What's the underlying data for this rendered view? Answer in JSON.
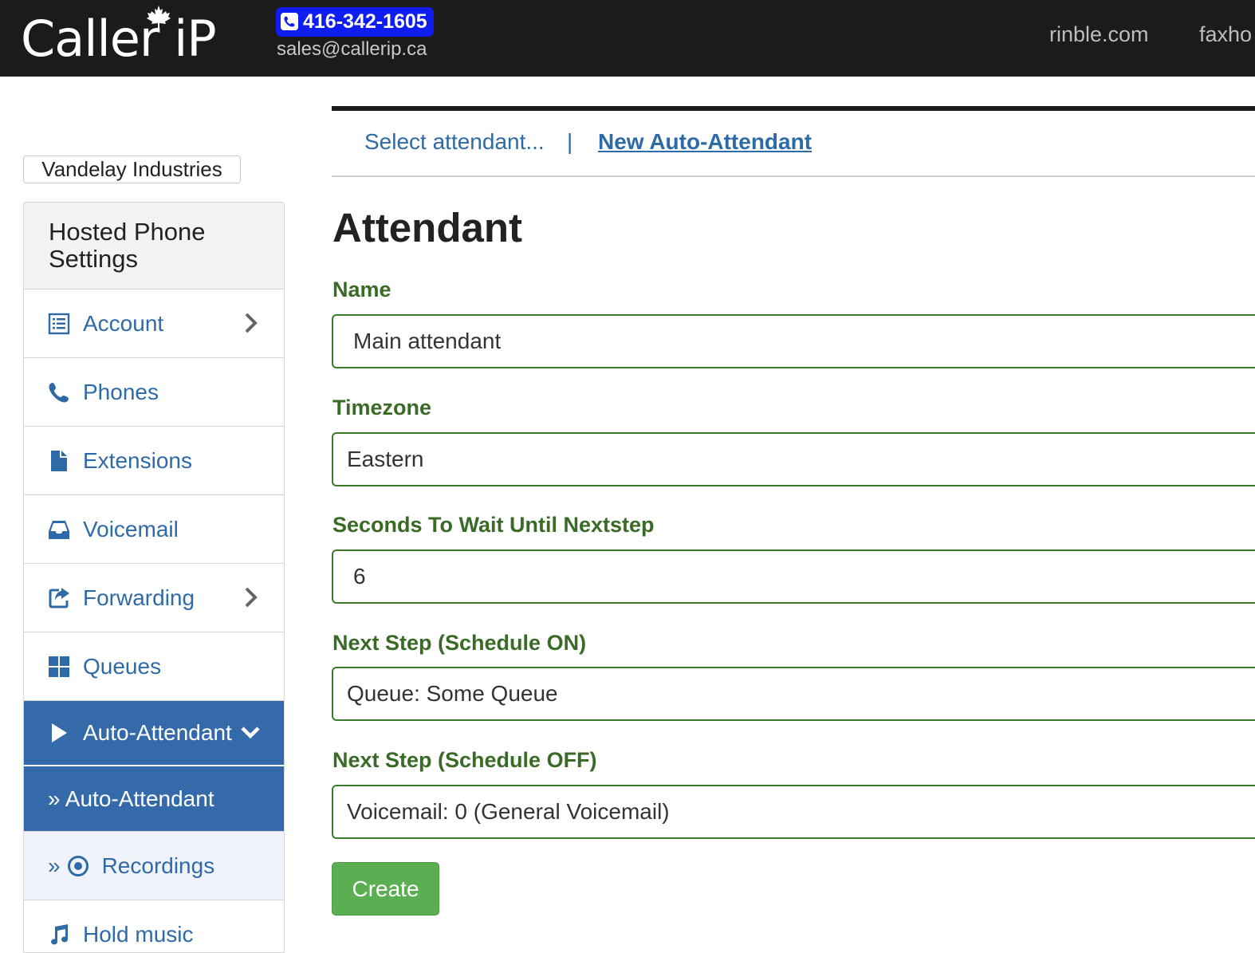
{
  "header": {
    "logo_text": "Caller iP",
    "phone": "416-342-1605",
    "email": "sales@callerip.ca",
    "links": [
      "rinble.com",
      "faxho"
    ]
  },
  "company": "Vandelay Industries",
  "sidebar": {
    "heading": "Hosted Phone Settings",
    "items": [
      {
        "label": "Account",
        "icon": "list-icon",
        "expandable": true
      },
      {
        "label": "Phones",
        "icon": "phone-icon"
      },
      {
        "label": "Extensions",
        "icon": "file-icon"
      },
      {
        "label": "Voicemail",
        "icon": "inbox-icon"
      },
      {
        "label": "Forwarding",
        "icon": "share-icon",
        "expandable": true
      },
      {
        "label": "Queues",
        "icon": "grid-icon"
      },
      {
        "label": "Auto-Attendant",
        "icon": "play-icon",
        "expanded": true,
        "active": true
      },
      {
        "label": "» Auto-Attendant",
        "active_sub": true
      },
      {
        "label": "Recordings",
        "prefix": "»",
        "icon": "record-icon"
      },
      {
        "label": "Hold music",
        "icon": "music-icon"
      }
    ]
  },
  "subnav": {
    "select_label": "Select attendant...",
    "separator": "|",
    "new_label": "New Auto-Attendant"
  },
  "form": {
    "title": "Attendant",
    "name_label": "Name",
    "name_value": "Main attendant",
    "timezone_label": "Timezone",
    "timezone_value": "Eastern",
    "wait_label": "Seconds To Wait Until Nextstep",
    "wait_value": "6",
    "next_on_label": "Next Step (Schedule ON)",
    "next_on_value": "Queue: Some Queue",
    "next_off_label": "Next Step (Schedule OFF)",
    "next_off_value": "Voicemail: 0 (General Voicemail)",
    "submit_label": "Create"
  },
  "colors": {
    "accent": "#346aa9",
    "link": "#2f6aa8",
    "label_green": "#3a6b26",
    "button_green": "#5cae53",
    "topbar": "#1b1b1b",
    "phone_badge": "#0f1ef0"
  }
}
